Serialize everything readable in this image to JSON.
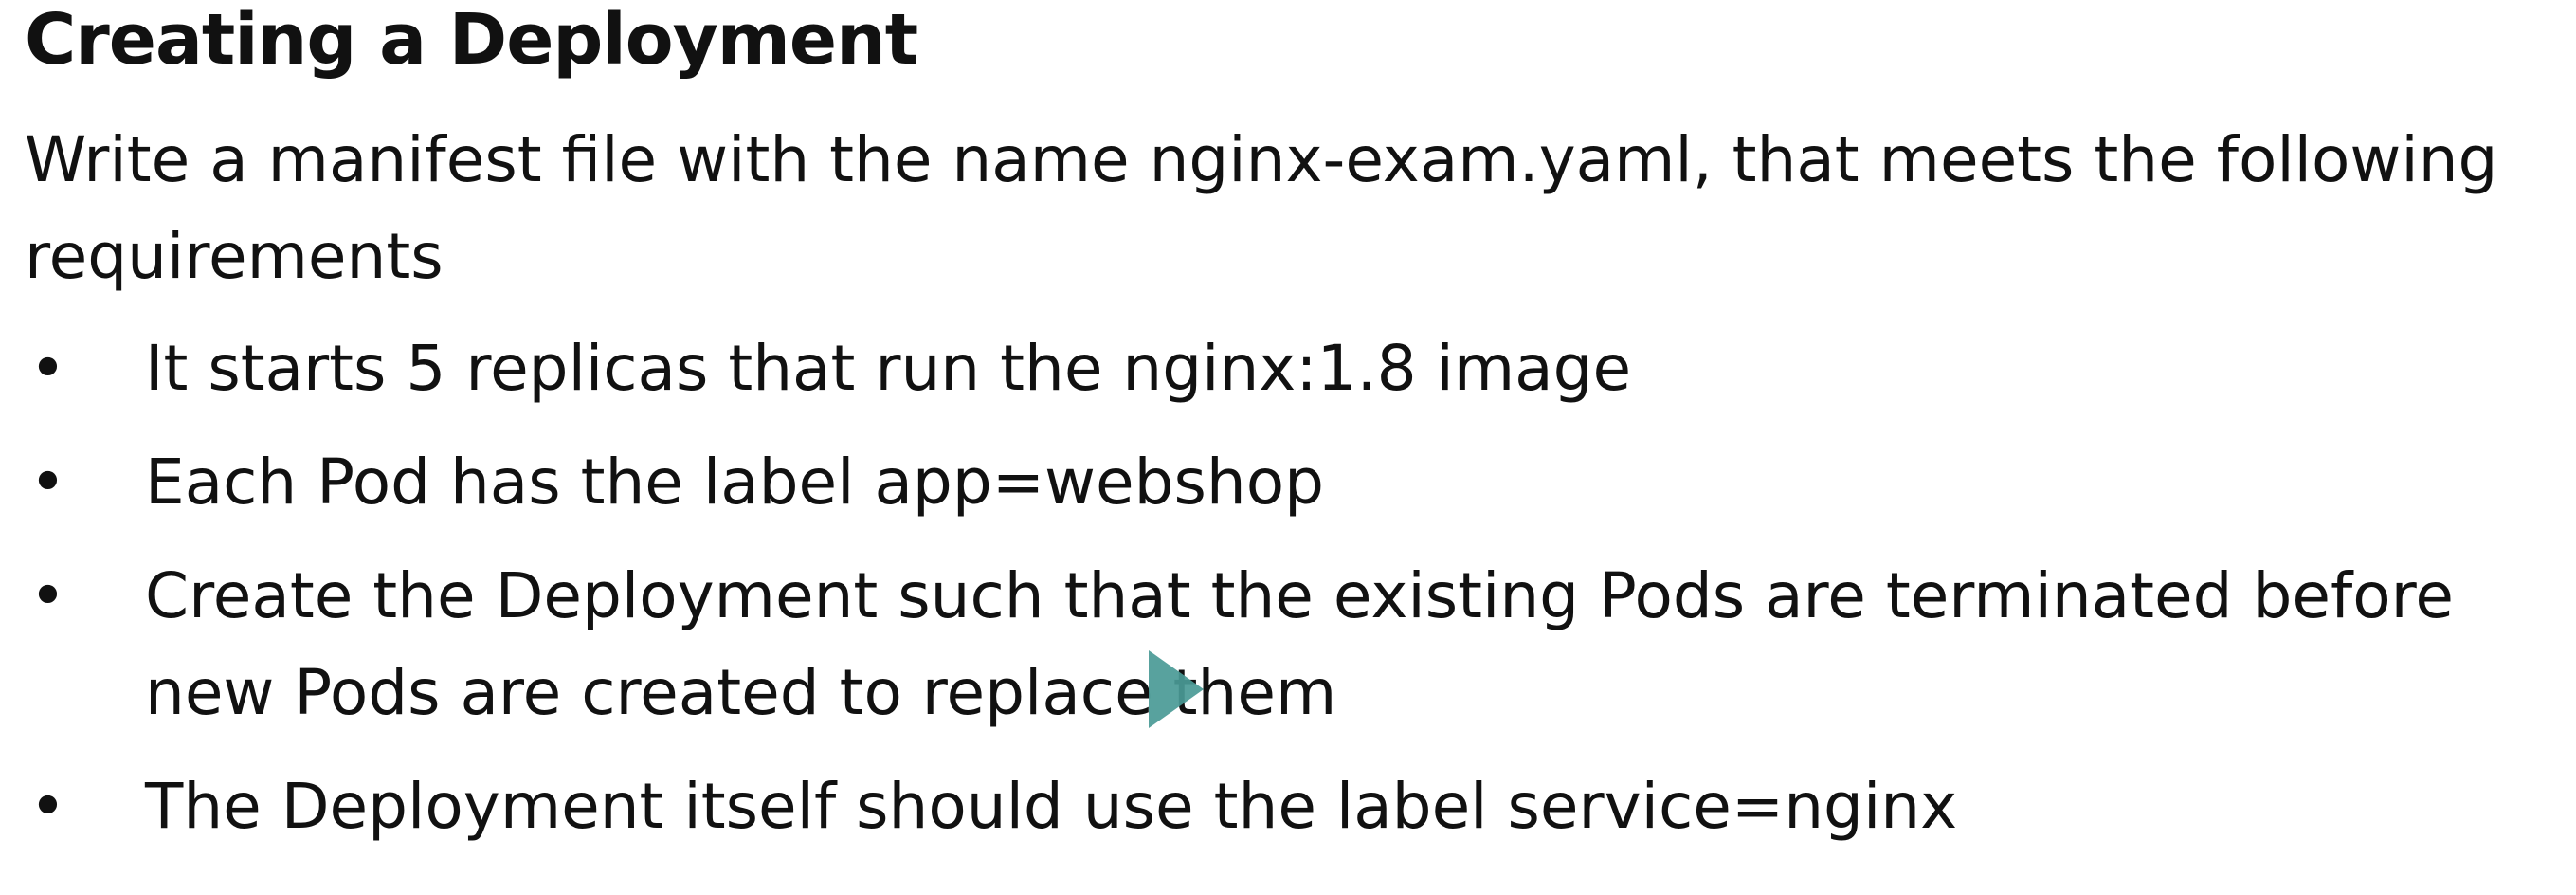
{
  "title": "Creating a Deployment",
  "intro": "Write a manifest file with the name nginx-exam.yaml, that meets the following requirements",
  "bullets": [
    {
      "marker": "•",
      "text": "It starts 5 replicas that run the nginx:1.8 image"
    },
    {
      "marker": "•",
      "text": "Each Pod has the label app=webshop"
    },
    {
      "marker": "•",
      "text": "Create the Deployment such that the existing Pods are terminated before new Pods are created to replace them"
    },
    {
      "marker": "•",
      "text": "The Deployment itself should use the label service=nginx"
    }
  ],
  "overlay": {
    "icon": "play-icon",
    "color": "#4a9a96"
  }
}
